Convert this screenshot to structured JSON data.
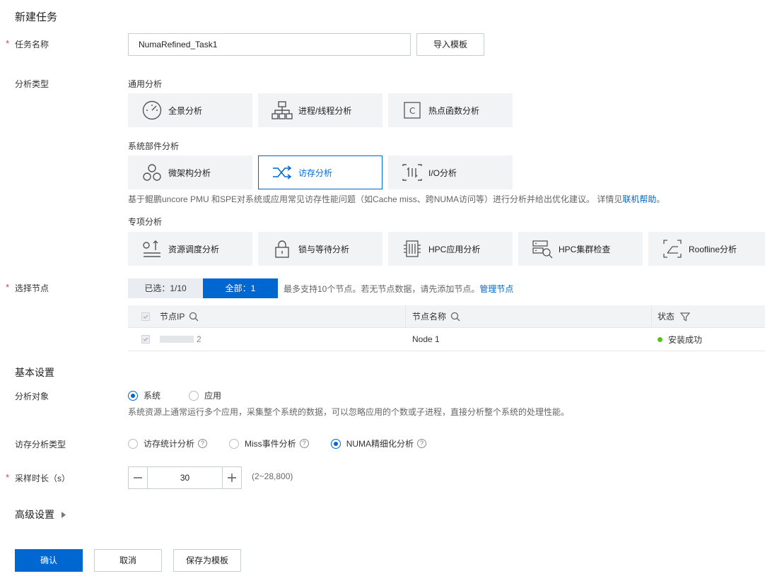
{
  "page": {
    "title": "新建任务"
  },
  "task_name": {
    "label": "任务名称",
    "value": "NumaRefined_Task1",
    "import_button": "导入模板"
  },
  "analysis_type": {
    "label": "分析类型",
    "general": {
      "label": "通用分析",
      "items": [
        {
          "label": "全景分析",
          "icon": "gauge-icon"
        },
        {
          "label": "进程/线程分析",
          "icon": "hierarchy-icon"
        },
        {
          "label": "热点函数分析",
          "icon": "c-function-icon"
        }
      ]
    },
    "component": {
      "label": "系统部件分析",
      "items": [
        {
          "label": "微架构分析",
          "icon": "molecule-icon"
        },
        {
          "label": "访存分析",
          "icon": "shuffle-icon",
          "selected": true
        },
        {
          "label": "I/O分析",
          "icon": "io-icon"
        }
      ],
      "description": "基于鲲鹏uncore PMU 和SPE对系统或应用常见访存性能问题（如Cache miss、跨NUMA访问等）进行分析并给出优化建议。 详情见",
      "help_link": "联机帮助",
      "description_end": "。"
    },
    "special": {
      "label": "专项分析",
      "items": [
        {
          "label": "资源调度分析",
          "icon": "schedule-icon"
        },
        {
          "label": "锁与等待分析",
          "icon": "lock-icon"
        },
        {
          "label": "HPC应用分析",
          "icon": "hpc-app-icon"
        },
        {
          "label": "HPC集群检查",
          "icon": "cluster-check-icon"
        },
        {
          "label": "Roofline分析",
          "icon": "roofline-icon"
        }
      ]
    }
  },
  "nodes": {
    "label": "选择节点",
    "selected_tab": "已选：1/10",
    "all_tab": "全部：1",
    "hint": "最多支持10个节点。若无节点数据，请先添加节点。",
    "manage_link": "管理节点",
    "columns": {
      "ip": "节点IP",
      "name": "节点名称",
      "status": "状态"
    },
    "rows": [
      {
        "ip_suffix": "2",
        "name": "Node 1",
        "status": "安装成功"
      }
    ]
  },
  "basic": {
    "title": "基本设置",
    "target": {
      "label": "分析对象",
      "options": [
        "系统",
        "应用"
      ],
      "selected": "系统",
      "description": "系统资源上通常运行多个应用，采集整个系统的数据，可以忽略应用的个数或子进程，直接分析整个系统的处理性能。"
    },
    "mem_type": {
      "label": "访存分析类型",
      "options": [
        "访存统计分析",
        "Miss事件分析",
        "NUMA精细化分析"
      ],
      "selected": "NUMA精细化分析"
    },
    "duration": {
      "label": "采样时长（s）",
      "value": "30",
      "range": "(2~28,800)"
    }
  },
  "advanced": {
    "title": "高级设置"
  },
  "actions": {
    "confirm": "确认",
    "cancel": "取消",
    "save_template": "保存为模板"
  },
  "colors": {
    "primary": "#0067d1",
    "required": "#e54545",
    "success": "#52c41a",
    "card_bg": "#f2f3f5"
  }
}
